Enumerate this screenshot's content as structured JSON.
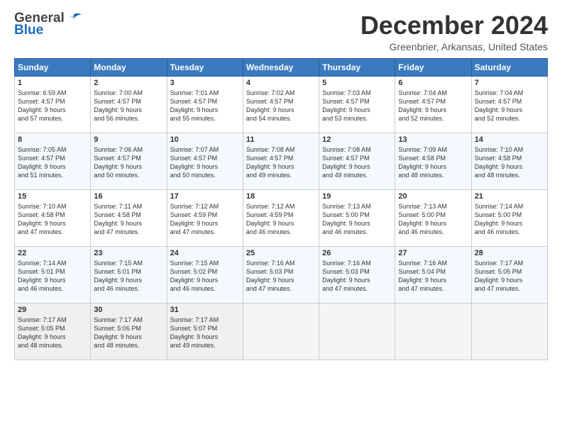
{
  "header": {
    "logo_general": "General",
    "logo_blue": "Blue",
    "month_title": "December 2024",
    "location": "Greenbrier, Arkansas, United States"
  },
  "weekdays": [
    "Sunday",
    "Monday",
    "Tuesday",
    "Wednesday",
    "Thursday",
    "Friday",
    "Saturday"
  ],
  "weeks": [
    [
      {
        "day": "1",
        "sunrise": "Sunrise: 6:59 AM",
        "sunset": "Sunset: 4:57 PM",
        "daylight": "Daylight: 9 hours and 57 minutes."
      },
      {
        "day": "2",
        "sunrise": "Sunrise: 7:00 AM",
        "sunset": "Sunset: 4:57 PM",
        "daylight": "Daylight: 9 hours and 56 minutes."
      },
      {
        "day": "3",
        "sunrise": "Sunrise: 7:01 AM",
        "sunset": "Sunset: 4:57 PM",
        "daylight": "Daylight: 9 hours and 55 minutes."
      },
      {
        "day": "4",
        "sunrise": "Sunrise: 7:02 AM",
        "sunset": "Sunset: 4:57 PM",
        "daylight": "Daylight: 9 hours and 54 minutes."
      },
      {
        "day": "5",
        "sunrise": "Sunrise: 7:03 AM",
        "sunset": "Sunset: 4:57 PM",
        "daylight": "Daylight: 9 hours and 53 minutes."
      },
      {
        "day": "6",
        "sunrise": "Sunrise: 7:04 AM",
        "sunset": "Sunset: 4:57 PM",
        "daylight": "Daylight: 9 hours and 52 minutes."
      },
      {
        "day": "7",
        "sunrise": "Sunrise: 7:04 AM",
        "sunset": "Sunset: 4:57 PM",
        "daylight": "Daylight: 9 hours and 52 minutes."
      }
    ],
    [
      {
        "day": "8",
        "sunrise": "Sunrise: 7:05 AM",
        "sunset": "Sunset: 4:57 PM",
        "daylight": "Daylight: 9 hours and 51 minutes."
      },
      {
        "day": "9",
        "sunrise": "Sunrise: 7:06 AM",
        "sunset": "Sunset: 4:57 PM",
        "daylight": "Daylight: 9 hours and 50 minutes."
      },
      {
        "day": "10",
        "sunrise": "Sunrise: 7:07 AM",
        "sunset": "Sunset: 4:57 PM",
        "daylight": "Daylight: 9 hours and 50 minutes."
      },
      {
        "day": "11",
        "sunrise": "Sunrise: 7:08 AM",
        "sunset": "Sunset: 4:57 PM",
        "daylight": "Daylight: 9 hours and 49 minutes."
      },
      {
        "day": "12",
        "sunrise": "Sunrise: 7:08 AM",
        "sunset": "Sunset: 4:57 PM",
        "daylight": "Daylight: 9 hours and 49 minutes."
      },
      {
        "day": "13",
        "sunrise": "Sunrise: 7:09 AM",
        "sunset": "Sunset: 4:58 PM",
        "daylight": "Daylight: 9 hours and 48 minutes."
      },
      {
        "day": "14",
        "sunrise": "Sunrise: 7:10 AM",
        "sunset": "Sunset: 4:58 PM",
        "daylight": "Daylight: 9 hours and 48 minutes."
      }
    ],
    [
      {
        "day": "15",
        "sunrise": "Sunrise: 7:10 AM",
        "sunset": "Sunset: 4:58 PM",
        "daylight": "Daylight: 9 hours and 47 minutes."
      },
      {
        "day": "16",
        "sunrise": "Sunrise: 7:11 AM",
        "sunset": "Sunset: 4:58 PM",
        "daylight": "Daylight: 9 hours and 47 minutes."
      },
      {
        "day": "17",
        "sunrise": "Sunrise: 7:12 AM",
        "sunset": "Sunset: 4:59 PM",
        "daylight": "Daylight: 9 hours and 47 minutes."
      },
      {
        "day": "18",
        "sunrise": "Sunrise: 7:12 AM",
        "sunset": "Sunset: 4:59 PM",
        "daylight": "Daylight: 9 hours and 46 minutes."
      },
      {
        "day": "19",
        "sunrise": "Sunrise: 7:13 AM",
        "sunset": "Sunset: 5:00 PM",
        "daylight": "Daylight: 9 hours and 46 minutes."
      },
      {
        "day": "20",
        "sunrise": "Sunrise: 7:13 AM",
        "sunset": "Sunset: 5:00 PM",
        "daylight": "Daylight: 9 hours and 46 minutes."
      },
      {
        "day": "21",
        "sunrise": "Sunrise: 7:14 AM",
        "sunset": "Sunset: 5:00 PM",
        "daylight": "Daylight: 9 hours and 46 minutes."
      }
    ],
    [
      {
        "day": "22",
        "sunrise": "Sunrise: 7:14 AM",
        "sunset": "Sunset: 5:01 PM",
        "daylight": "Daylight: 9 hours and 46 minutes."
      },
      {
        "day": "23",
        "sunrise": "Sunrise: 7:15 AM",
        "sunset": "Sunset: 5:01 PM",
        "daylight": "Daylight: 9 hours and 46 minutes."
      },
      {
        "day": "24",
        "sunrise": "Sunrise: 7:15 AM",
        "sunset": "Sunset: 5:02 PM",
        "daylight": "Daylight: 9 hours and 46 minutes."
      },
      {
        "day": "25",
        "sunrise": "Sunrise: 7:16 AM",
        "sunset": "Sunset: 5:03 PM",
        "daylight": "Daylight: 9 hours and 47 minutes."
      },
      {
        "day": "26",
        "sunrise": "Sunrise: 7:16 AM",
        "sunset": "Sunset: 5:03 PM",
        "daylight": "Daylight: 9 hours and 47 minutes."
      },
      {
        "day": "27",
        "sunrise": "Sunrise: 7:16 AM",
        "sunset": "Sunset: 5:04 PM",
        "daylight": "Daylight: 9 hours and 47 minutes."
      },
      {
        "day": "28",
        "sunrise": "Sunrise: 7:17 AM",
        "sunset": "Sunset: 5:05 PM",
        "daylight": "Daylight: 9 hours and 47 minutes."
      }
    ],
    [
      {
        "day": "29",
        "sunrise": "Sunrise: 7:17 AM",
        "sunset": "Sunset: 5:05 PM",
        "daylight": "Daylight: 9 hours and 48 minutes."
      },
      {
        "day": "30",
        "sunrise": "Sunrise: 7:17 AM",
        "sunset": "Sunset: 5:06 PM",
        "daylight": "Daylight: 9 hours and 48 minutes."
      },
      {
        "day": "31",
        "sunrise": "Sunrise: 7:17 AM",
        "sunset": "Sunset: 5:07 PM",
        "daylight": "Daylight: 9 hours and 49 minutes."
      },
      {
        "day": "",
        "sunrise": "",
        "sunset": "",
        "daylight": ""
      },
      {
        "day": "",
        "sunrise": "",
        "sunset": "",
        "daylight": ""
      },
      {
        "day": "",
        "sunrise": "",
        "sunset": "",
        "daylight": ""
      },
      {
        "day": "",
        "sunrise": "",
        "sunset": "",
        "daylight": ""
      }
    ]
  ]
}
